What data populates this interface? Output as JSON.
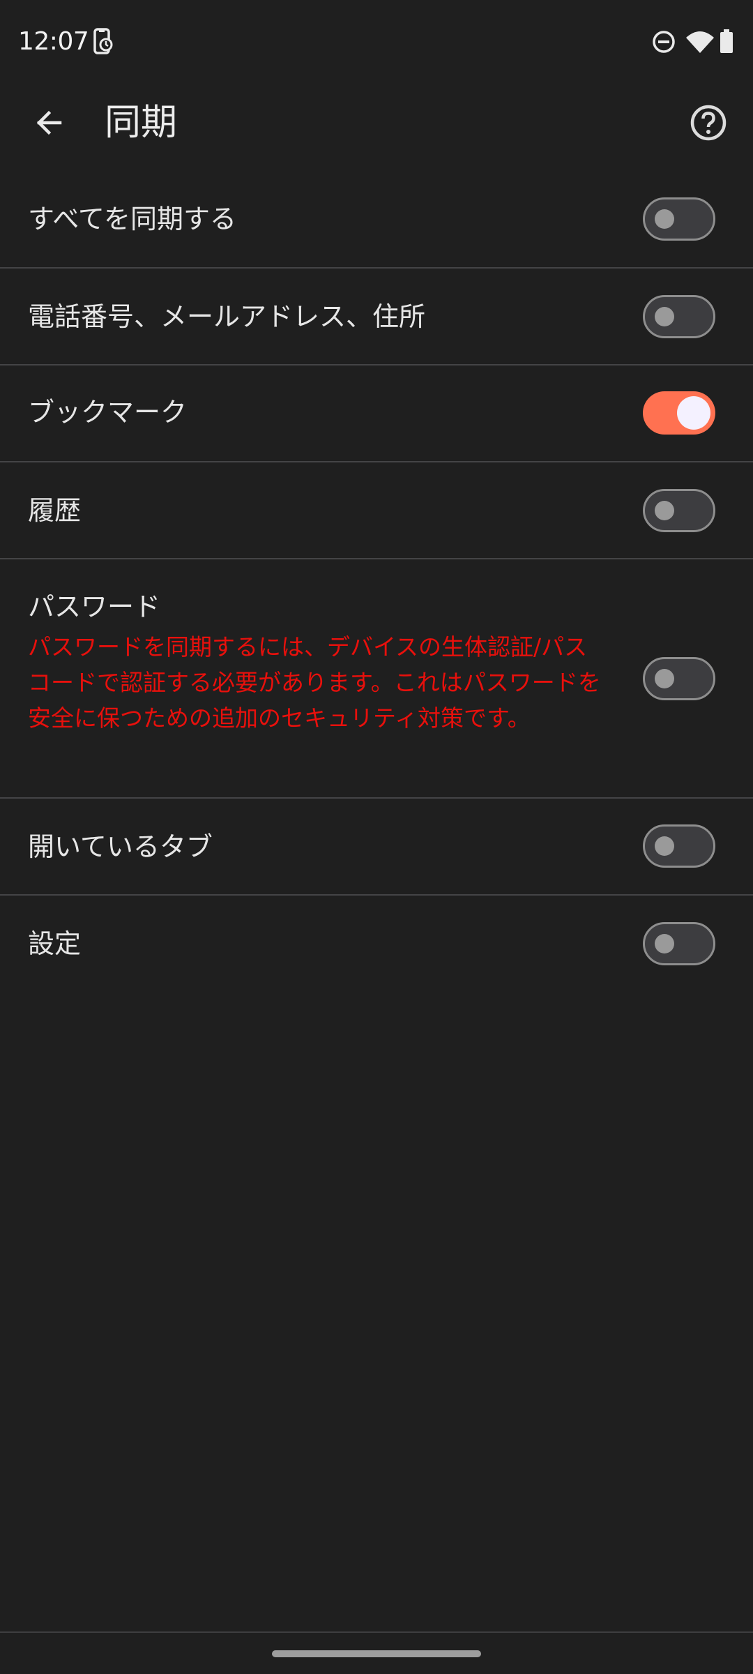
{
  "status_bar": {
    "time": "12:07",
    "icons": [
      "screen-record-icon",
      "dnd-icon",
      "wifi-icon",
      "battery-icon"
    ]
  },
  "app_bar": {
    "title": "同期",
    "back_icon": "arrow-back-icon",
    "help_icon": "help-circle-icon"
  },
  "settings": {
    "items": [
      {
        "label": "すべてを同期する",
        "checked": false
      },
      {
        "label": "電話番号、メールアドレス、住所",
        "checked": false
      },
      {
        "label": "ブックマーク",
        "checked": true
      },
      {
        "label": "履歴",
        "checked": false
      },
      {
        "label": "パスワード",
        "description": "パスワードを同期するには、デバイスの生体認証/パスコードで認証する必要があります。これはパスワードを安全に保つための追加のセキュリティ対策です。",
        "checked": false
      },
      {
        "label": "開いているタブ",
        "checked": false
      },
      {
        "label": "設定",
        "checked": false
      }
    ]
  },
  "colors": {
    "background": "#1f1f1f",
    "accent": "#ff7151",
    "warning_text": "#e8100c"
  }
}
